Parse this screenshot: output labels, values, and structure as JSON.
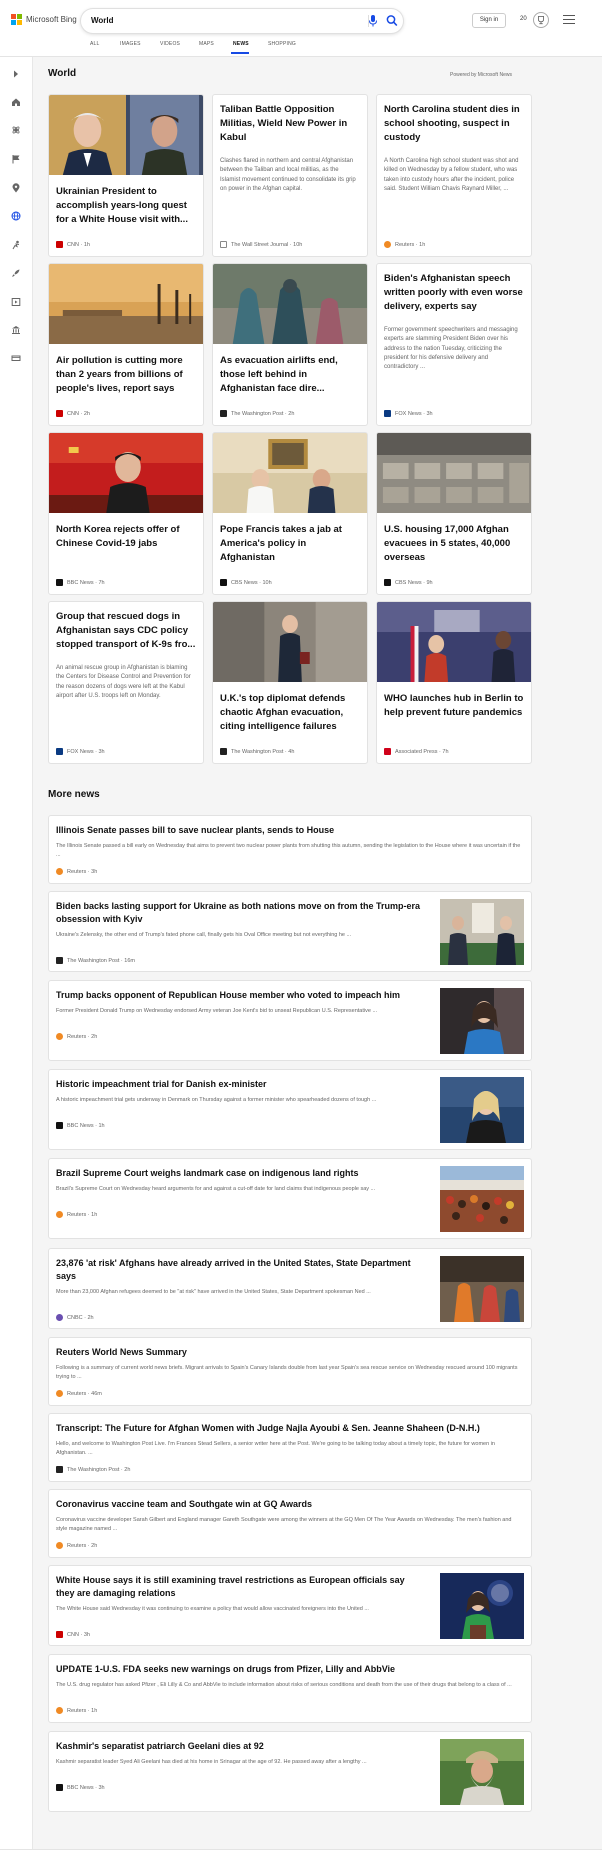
{
  "brand": {
    "name": "Microsoft Bing",
    "logo_colors": [
      "#f25022",
      "#7fba00",
      "#00a4ef",
      "#ffb900"
    ]
  },
  "search": {
    "query": "World",
    "mic_icon": "mic-icon",
    "search_icon": "search-icon"
  },
  "header": {
    "sign_in_label": "Sign in",
    "rewards_count": "20",
    "rewards_icon": "trophy-icon",
    "menu_icon": "hamburger-icon"
  },
  "scopes": [
    {
      "label": "ALL",
      "active": false
    },
    {
      "label": "IMAGES",
      "active": false
    },
    {
      "label": "VIDEOS",
      "active": false
    },
    {
      "label": "MAPS",
      "active": false
    },
    {
      "label": "NEWS",
      "active": true
    },
    {
      "label": "SHOPPING",
      "active": false
    }
  ],
  "rail_icons": [
    "chevron-right-icon",
    "home-icon",
    "science-icon",
    "flag-icon",
    "location-pin-icon",
    "globe-icon",
    "sports-icon",
    "rocket-icon",
    "entertainment-icon",
    "bank-icon",
    "money-icon"
  ],
  "colors": {
    "accent": "#174ae4",
    "rail_active": "#174ae4"
  },
  "world": {
    "title": "World",
    "powered_by": "Powered by Microsoft News",
    "cards": [
      {
        "title": "Ukrainian President to accomplish years-long quest for a White House visit with...",
        "desc": "",
        "source": "CNN",
        "age": "1h",
        "src_color": "#cc0000"
      },
      {
        "title": "Taliban Battle Opposition Militias, Wield New Power in Kabul",
        "desc": "Clashes flared in northern and central Afghanistan between the Taliban and local militias, as the Islamist movement continued to consolidate its grip on power in the Afghan capital.",
        "source": "The Wall Street Journal",
        "age": "10h",
        "src_color": "#333333"
      },
      {
        "title": "North Carolina student dies in school shooting, suspect in custody",
        "desc": "A North Carolina high school student was shot and killed on Wednesday by a fellow student, who was taken into custody hours after the incident, police said. Student William Chavis Raynard Miller, ...",
        "source": "Reuters",
        "age": "1h",
        "src_color": "#f08a24"
      },
      {
        "title": "Air pollution is cutting more than 2 years from billions of people's lives, report says",
        "desc": "",
        "source": "CNN",
        "age": "2h",
        "src_color": "#cc0000"
      },
      {
        "title": "As evacuation airlifts end, those left behind in Afghanistan face dire...",
        "desc": "",
        "source": "The Washington Post",
        "age": "2h",
        "src_color": "#222222"
      },
      {
        "title": "Biden's Afghanistan speech written poorly with even worse delivery, experts say",
        "desc": "Former government speechwriters and messaging experts are slamming President Biden over his address to the nation Tuesday, criticizing the president for his defensive delivery and contradictory ...",
        "source": "FOX News",
        "age": "3h",
        "src_color": "#0a3a82"
      },
      {
        "title": "North Korea rejects offer of Chinese Covid-19 jabs",
        "desc": "",
        "source": "BBC News",
        "age": "7h",
        "src_color": "#111111"
      },
      {
        "title": "Pope Francis takes a jab at America's policy in Afghanistan",
        "desc": "",
        "source": "CBS News",
        "age": "10h",
        "src_color": "#111111"
      },
      {
        "title": "U.S. housing 17,000 Afghan evacuees in 5 states, 40,000 overseas",
        "desc": "",
        "source": "CBS News",
        "age": "9h",
        "src_color": "#111111"
      },
      {
        "title": "Group that rescued dogs in Afghanistan says CDC policy stopped transport of K-9s fro...",
        "desc": "An animal rescue group in Afghanistan is blaming the Centers for Disease Control and Prevention for the reason dozens of dogs were left at the Kabul airport after U.S. troops left on Monday.",
        "source": "FOX News",
        "age": "3h",
        "src_color": "#0a3a82"
      },
      {
        "title": "U.K.'s top diplomat defends chaotic Afghan evacuation, citing intelligence failures",
        "desc": "",
        "source": "The Washington Post",
        "age": "4h",
        "src_color": "#222222"
      },
      {
        "title": "WHO launches hub in Berlin to help prevent future pandemics",
        "desc": "",
        "source": "Associated Press",
        "age": "7h",
        "src_color": "#d0021b"
      }
    ]
  },
  "more_news": {
    "title": "More news",
    "items": [
      {
        "title": "Illinois Senate passes bill to save nuclear plants, sends to House",
        "snippet": "The Illinois Senate passed a bill early on Wednesday that aims to prevent two nuclear power plants from shutting this autumn, sending the legislation to the House where it was uncertain if the ...",
        "source": "Reuters",
        "age": "3h",
        "src_color": "#f08a24"
      },
      {
        "title": "Biden backs lasting support for Ukraine as both nations move on from the Trump-era obsession with Kyiv",
        "snippet": "Ukraine's Zelensky, the other end of Trump's fated phone call, finally gets his Oval Office meeting but not everything he ...",
        "source": "The Washington Post",
        "age": "16m",
        "src_color": "#222222"
      },
      {
        "title": "Trump backs opponent of Republican House member who voted to impeach him",
        "snippet": "Former President Donald Trump on Wednesday endorsed Army veteran Joe Kent's bid to unseat Republican U.S. Representative ...",
        "source": "Reuters",
        "age": "2h",
        "src_color": "#f08a24"
      },
      {
        "title": "Historic impeachment trial for Danish ex-minister",
        "snippet": "A historic impeachment trial gets underway in Denmark on Thursday against a former minister who spearheaded dozens of tough ...",
        "source": "BBC News",
        "age": "1h",
        "src_color": "#111111"
      },
      {
        "title": "Brazil Supreme Court weighs landmark case on indigenous land rights",
        "snippet": "Brazil's Supreme Court on Wednesday heard arguments for and against a cut-off date for land claims that indigenous people say ...",
        "source": "Reuters",
        "age": "1h",
        "src_color": "#f08a24"
      },
      {
        "title": "23,876 'at risk' Afghans have already arrived in the United States, State Department says",
        "snippet": "More than 23,000 Afghan refugees deemed to be \"at risk\" have arrived in the United States, State Department spokesman Ned ...",
        "source": "CNBC",
        "age": "2h",
        "src_color": "#6a4fb0"
      },
      {
        "title": "Reuters World News Summary",
        "snippet": "Following is a summary of current world news briefs. Migrant arrivals to Spain's Canary Islands double from last year Spain's sea rescue service on Wednesday rescued around 100 migrants trying to ...",
        "source": "Reuters",
        "age": "46m",
        "src_color": "#f08a24"
      },
      {
        "title": "Transcript: The Future for Afghan Women with Judge Najla Ayoubi & Sen. Jeanne Shaheen (D-N.H.)",
        "snippet": "Hello, and welcome to Washington Post Live. I'm Frances Stead Sellers, a senior writer here at the Post. We're going to be talking today about a timely topic, the future for women in Afghanistan. ...",
        "source": "The Washington Post",
        "age": "2h",
        "src_color": "#222222"
      },
      {
        "title": "Coronavirus vaccine team and Southgate win at GQ Awards",
        "snippet": "Coronavirus vaccine developer Sarah Gilbert and England manager Gareth Southgate were among the winners at the GQ Men Of The Year Awards on Wednesday. The men's fashion and style magazine named ...",
        "source": "Reuters",
        "age": "2h",
        "src_color": "#f08a24"
      },
      {
        "title": "White House says it is still examining travel restrictions as European officials say they are damaging relations",
        "snippet": "The White House said Wednesday it was continuing to examine a policy that would allow vaccinated foreigners into the United ...",
        "source": "CNN",
        "age": "3h",
        "src_color": "#cc0000"
      },
      {
        "title": "UPDATE 1-U.S. FDA seeks new warnings on drugs from Pfizer, Lilly and AbbVie",
        "snippet": "The U.S. drug regulator has asked Pfizer , Eli Lilly & Co and AbbVie to include information about risks of serious conditions and death from the use of their drugs that belong to a class of ...",
        "source": "Reuters",
        "age": "1h",
        "src_color": "#f08a24"
      },
      {
        "title": "Kashmir's separatist patriarch Geelani dies at 92",
        "snippet": "Kashmir separatist leader Syed Ali Geelani has died at his home in Srinagar at the age of 92. He passed away after a lengthy ...",
        "source": "BBC News",
        "age": "3h",
        "src_color": "#111111"
      }
    ]
  }
}
